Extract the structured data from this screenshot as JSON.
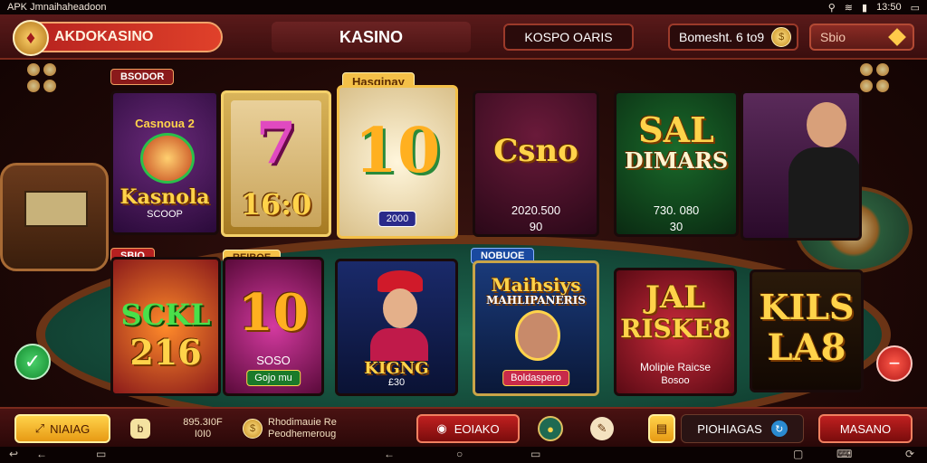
{
  "statusbar": {
    "title": "APK Jmnaihaheadoon",
    "time": "13:50",
    "icons": [
      "location-icon",
      "wifi-icon",
      "signal-icon",
      "battery-icon"
    ]
  },
  "topbar": {
    "brand": "AKDOKASINO",
    "title": "KASINO",
    "btn1": "KOSPO OARIS",
    "btn2": "Bomesht. 6 to9",
    "btn3": "Sbio"
  },
  "chips": {
    "top": "BSODOR",
    "mid": "SBIO",
    "blue": "NOBUOE"
  },
  "tiles": {
    "t1": {
      "title": "Kasnola",
      "sub": "SCOOP",
      "top": "Casnoua 2"
    },
    "t2": {
      "big": "7",
      "num": "16:0"
    },
    "t3": {
      "chip": "Hasginay",
      "big": "10",
      "pill": "2000"
    },
    "t4": {
      "big": "Csno",
      "line1": "2020.500",
      "line2": "90"
    },
    "t5": {
      "big1": "SAL",
      "big2": "DIMARS",
      "line1": "730. 080",
      "line2": "30"
    },
    "t6": {},
    "t7": {
      "big1": "SCKL",
      "big2": "216"
    },
    "t8": {
      "chip": "REIBOE",
      "big": "10",
      "line1": "SOSO",
      "pill": "Gojo mu"
    },
    "t9": {
      "big": "KIGNG",
      "sub": "£30"
    },
    "t10": {
      "big1": "Maihsiys",
      "big2": "MAHLIPANERIS",
      "pill": "Boldaspero"
    },
    "t11": {
      "big1": "JAL",
      "big2": "RISKE8",
      "line1": "Molipie Raicse",
      "line2": "Bosoo"
    },
    "t12": {
      "big1": "KILS",
      "big2": "LA8"
    }
  },
  "bottombar": {
    "btn1": "NIAIAG",
    "btn2": "b",
    "stat1": "895.3I0F",
    "stat2": "I0I0",
    "info1": "Rhodimauie Re",
    "info2": "Peodhemeroug",
    "btn5": "EOIAKO",
    "btn9": "PIOHIAGAS",
    "btn10": "MASANO"
  },
  "colors": {
    "accent_gold": "#ffd34a",
    "brand_red": "#e0412a",
    "felt_green": "#1f6a52"
  }
}
